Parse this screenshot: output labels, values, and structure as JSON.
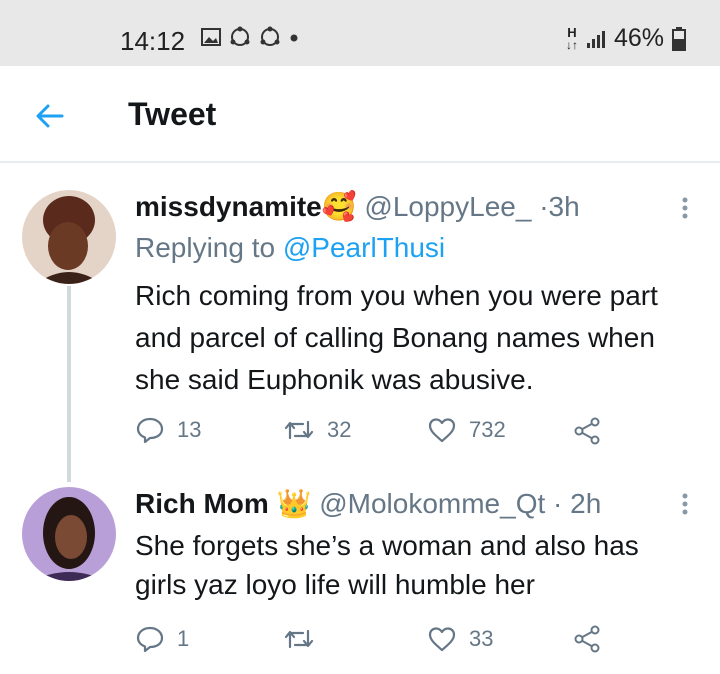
{
  "status_bar": {
    "time": "14:12",
    "battery": "46%",
    "network_label": "H"
  },
  "header": {
    "title": "Tweet"
  },
  "tweets": [
    {
      "display_name": "missdynamite",
      "emoji": "🥰",
      "handle": "@LoppyLee_",
      "sep": "·",
      "time": "3h",
      "replying_prefix": "Replying to ",
      "replying_to": "@PearlThusi",
      "text_lines": [
        "Rich coming from you when you were part",
        "and parcel of calling Bonang names when",
        "she said Euphonik was abusive."
      ],
      "replies": "13",
      "retweets": "32",
      "likes": "732"
    },
    {
      "display_name": "Rich Mom",
      "emoji": "👑",
      "handle": "@Molokomme_Qt",
      "sep": "·",
      "time": "2h",
      "text_lines": [
        "She forgets she’s a woman and also has",
        "girls yaz loyo life will humble her"
      ],
      "replies": "1",
      "retweets": "",
      "likes": "33"
    }
  ],
  "colors": {
    "accent": "#1da1f2",
    "secondary_text": "#657786",
    "status_bar": "#e8e8e8"
  },
  "icons": [
    "back-arrow-icon",
    "reply-icon",
    "retweet-icon",
    "like-icon",
    "share-icon",
    "more-icon"
  ]
}
